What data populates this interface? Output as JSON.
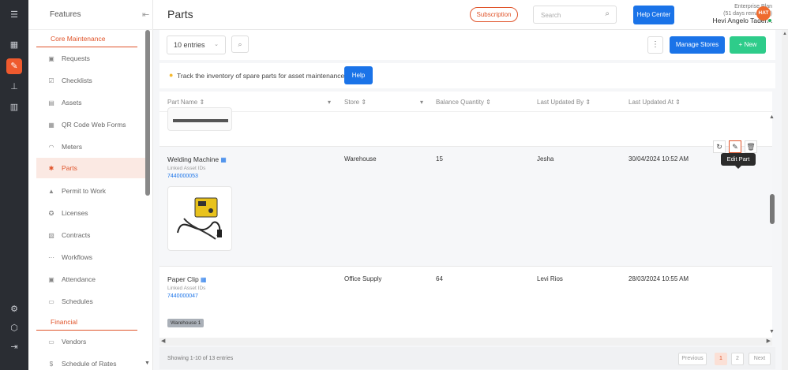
{
  "rail": {
    "icons": [
      "menu-toggle-icon",
      "dashboard-icon",
      "maintenance-icon",
      "hierarchy-icon",
      "analytics-icon",
      "settings-icon",
      "box-icon",
      "logout-icon"
    ]
  },
  "sidebar": {
    "title": "Features",
    "sections": [
      {
        "label": "Core Maintenance"
      },
      {
        "label": "Financial"
      }
    ],
    "items": [
      {
        "label": "Requests"
      },
      {
        "label": "Checklists"
      },
      {
        "label": "Assets"
      },
      {
        "label": "QR Code Web Forms"
      },
      {
        "label": "Meters"
      },
      {
        "label": "Parts"
      },
      {
        "label": "Permit to Work"
      },
      {
        "label": "Licenses"
      },
      {
        "label": "Contracts"
      },
      {
        "label": "Workflows"
      },
      {
        "label": "Attendance"
      },
      {
        "label": "Schedules"
      }
    ],
    "financial_items": [
      {
        "label": "Vendors"
      },
      {
        "label": "Schedule of Rates"
      }
    ]
  },
  "topbar": {
    "title": "Parts",
    "subscription": "Subscription",
    "search_placeholder": "Search",
    "help_center": "Help Center",
    "plan": "Enterprise Plan",
    "plan_days": "(51 days remaining)",
    "user": "Hevi Angelo Tadena",
    "avatar": "HAT"
  },
  "toolbar": {
    "entries": "10 entries",
    "manage_stores": "Manage Stores",
    "new": "+ New"
  },
  "banner": {
    "text": "Track the inventory of spare parts for asset maintenance",
    "help": "Help"
  },
  "table": {
    "headers": [
      "Part Name",
      "Store",
      "Balance Quantity",
      "Last Updated By",
      "Last Updated At"
    ],
    "rows": [
      {
        "name": "Welding Machine",
        "linked_label": "Linked Asset IDs",
        "asset_id": "7440000053",
        "store": "Warehouse",
        "qty": "15",
        "updated_by": "Jesha",
        "updated_at": "30/04/2024 10:52 AM"
      },
      {
        "name": "Paper Clip",
        "linked_label": "Linked Asset IDs",
        "asset_id": "7440000047",
        "store": "Office Supply",
        "qty": "64",
        "updated_by": "Levi Rios",
        "updated_at": "28/03/2024 10:55 AM",
        "tag": "Warehouse 1"
      }
    ],
    "tooltip": "Edit Part"
  },
  "footer": {
    "showing": "Showing 1-10 of 13 entries",
    "previous": "Previous",
    "pages": [
      "1",
      "2"
    ],
    "next": "Next"
  },
  "colors": {
    "accent": "#e0542a",
    "primary": "#1a73e8",
    "success": "#2ecc8a"
  }
}
